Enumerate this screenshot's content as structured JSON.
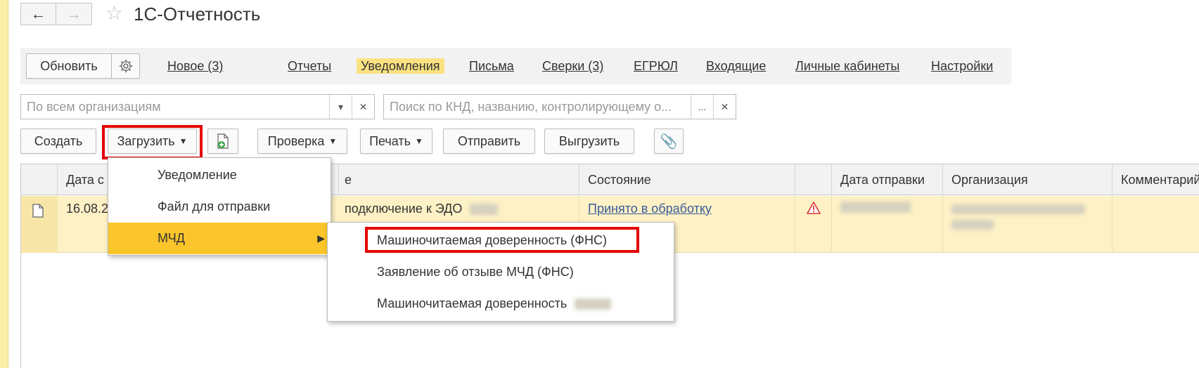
{
  "header": {
    "title": "1С-Отчетность"
  },
  "topbar": {
    "refresh_label": "Обновить",
    "links": [
      "Новое (3)",
      "Отчеты",
      "Уведомления",
      "Письма",
      "Сверки (3)",
      "ЕГРЮЛ",
      "Входящие",
      "Личные кабинеты",
      "Настройки"
    ]
  },
  "filters": {
    "org_placeholder": "По всем организациям",
    "search_placeholder": "Поиск по КНД, названию, контролирующему о..."
  },
  "toolbar": {
    "create": "Создать",
    "load": "Загрузить",
    "check": "Проверка",
    "print": "Печать",
    "send": "Отправить",
    "unload": "Выгрузить"
  },
  "table": {
    "headers": [
      "Дата с",
      "е",
      "Состояние",
      "Дата отправки",
      "Организация",
      "Комментарий"
    ],
    "rows": [
      {
        "date": "16.08.2",
        "name": "подключение к ЭДО",
        "status": "Принято в обработку"
      }
    ]
  },
  "menus": {
    "load_menu": [
      "Уведомление",
      "Файл для отправки",
      "МЧД"
    ],
    "mchd_submenu": [
      "Машиночитаемая доверенность (ФНС)",
      "Заявление об отзыве МЧД (ФНС)",
      "Машиночитаемая доверенность"
    ]
  },
  "colors": {
    "highlight": "#e30000",
    "selected": "#f9c52a",
    "active_tab": "#fbe281",
    "row": "#fdf1c5"
  }
}
